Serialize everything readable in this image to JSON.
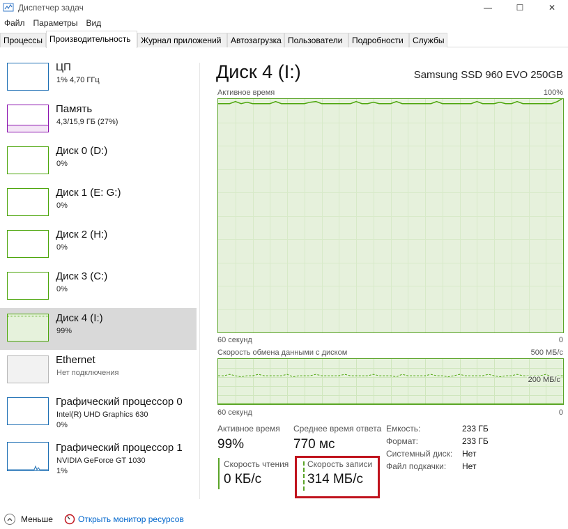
{
  "window": {
    "title": "Диспетчер задач",
    "controls": {
      "minimize": "—",
      "maximize": "☐",
      "close": "✕"
    }
  },
  "menu": [
    "Файл",
    "Параметры",
    "Вид"
  ],
  "tabs": [
    {
      "label": "Процессы",
      "active": false
    },
    {
      "label": "Производительность",
      "active": true
    },
    {
      "label": "Журнал приложений",
      "active": false
    },
    {
      "label": "Автозагрузка",
      "active": false
    },
    {
      "label": "Пользователи",
      "active": false
    },
    {
      "label": "Подробности",
      "active": false
    },
    {
      "label": "Службы",
      "active": false
    }
  ],
  "sidebar": {
    "items": [
      {
        "title": "ЦП",
        "sub1": "1% 4,70 ГГц",
        "sub2": "",
        "color": "#1e6fb4",
        "selected": false
      },
      {
        "title": "Память",
        "sub1": "4,3/15,9 ГБ (27%)",
        "sub2": "",
        "color": "#8b12ae",
        "selected": false
      },
      {
        "title": "Диск 0 (D:)",
        "sub1": "0%",
        "sub2": "",
        "color": "#4da60c",
        "selected": false
      },
      {
        "title": "Диск 1 (E: G:)",
        "sub1": "0%",
        "sub2": "",
        "color": "#4da60c",
        "selected": false
      },
      {
        "title": "Диск 2 (H:)",
        "sub1": "0%",
        "sub2": "",
        "color": "#4da60c",
        "selected": false
      },
      {
        "title": "Диск 3 (C:)",
        "sub1": "0%",
        "sub2": "",
        "color": "#4da60c",
        "selected": false
      },
      {
        "title": "Диск 4 (I:)",
        "sub1": "99%",
        "sub2": "",
        "color": "#4da60c",
        "selected": true
      },
      {
        "title": "Ethernet",
        "sub1": "Нет подключения",
        "sub2": "",
        "color": "#b8b8b8",
        "selected": false
      },
      {
        "title": "Графический процессор 0",
        "sub1": "Intel(R) UHD Graphics 630",
        "sub2": "0%",
        "color": "#1e6fb4",
        "selected": false
      },
      {
        "title": "Графический процессор 1",
        "sub1": "NVIDIA GeForce GT 1030",
        "sub2": "1%",
        "color": "#1e6fb4",
        "selected": false
      }
    ]
  },
  "main": {
    "title": "Диск 4 (I:)",
    "device": "Samsung SSD 960 EVO 250GB",
    "graph1": {
      "label": "Активное время",
      "max_label": "100%",
      "time_left": "60 секунд",
      "time_right": "0",
      "level_pct": 98
    },
    "graph2": {
      "label": "Скорость обмена данными с диском",
      "max_label": "500 МБ/с",
      "mid_label": "200 МБ/с",
      "time_left": "60 секунд",
      "time_right": "0",
      "level_fraction": 0.63
    },
    "stats": {
      "active_time_label": "Активное время",
      "active_time_value": "99%",
      "response_label": "Среднее время ответа",
      "response_value": "770 мс",
      "read_label": "Скорость чтения",
      "read_value": "0 КБ/с",
      "write_label": "Скорость записи",
      "write_value": "314 МБ/с"
    },
    "props": [
      {
        "label": "Емкость:",
        "value": "233 ГБ"
      },
      {
        "label": "Формат:",
        "value": "233 ГБ"
      },
      {
        "label": "Системный диск:",
        "value": "Нет"
      },
      {
        "label": "Файл подкачки:",
        "value": "Нет"
      }
    ]
  },
  "footer": {
    "less_label": "Меньше",
    "resmon_label": "Открыть монитор ресурсов"
  },
  "colors": {
    "disk_green": "#4da60c",
    "graph_fill": "#e6f2dc",
    "highlight_red": "#c0141e",
    "link_blue": "#0066cc"
  }
}
